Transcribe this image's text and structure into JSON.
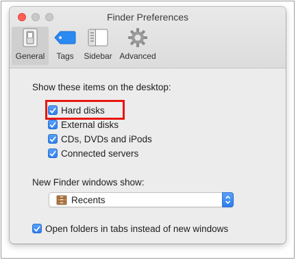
{
  "window": {
    "title": "Finder Preferences"
  },
  "toolbar": {
    "items": [
      {
        "label": "General",
        "icon": "switch-icon",
        "selected": true
      },
      {
        "label": "Tags",
        "icon": "tag-icon",
        "selected": false
      },
      {
        "label": "Sidebar",
        "icon": "sidebar-icon",
        "selected": false
      },
      {
        "label": "Advanced",
        "icon": "gear-icon",
        "selected": false
      }
    ]
  },
  "desktop": {
    "heading": "Show these items on the desktop:",
    "items": [
      {
        "label": "Hard disks",
        "checked": true,
        "highlighted": true
      },
      {
        "label": "External disks",
        "checked": true
      },
      {
        "label": "CDs, DVDs and iPods",
        "checked": true
      },
      {
        "label": "Connected servers",
        "checked": true
      }
    ]
  },
  "new_window": {
    "heading": "New Finder windows show:",
    "selected": "Recents",
    "icon": "recents-icon"
  },
  "tabs_option": {
    "label": "Open folders in tabs instead of new windows",
    "checked": true
  },
  "colors": {
    "accent": "#2c7ef0",
    "highlight": "#e8140f",
    "close": "#fe5f57"
  }
}
